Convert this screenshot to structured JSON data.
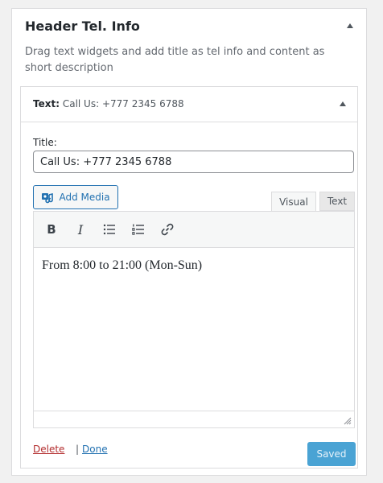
{
  "sidebar": {
    "title": "Header Tel. Info",
    "description": "Drag text widgets and add title as tel info and content as short description"
  },
  "widget": {
    "type_label": "Text:",
    "title_summary": "Call Us: +777 2345 6788",
    "title_label": "Title:",
    "title_value": "Call Us: +777 2345 6788",
    "add_media_label": "Add Media",
    "tabs": {
      "visual": "Visual",
      "text": "Text"
    },
    "toolbar_icons": [
      "bold-icon",
      "italic-icon",
      "bulleted-list-icon",
      "numbered-list-icon",
      "link-icon"
    ],
    "content": "From 8:00 to 21:00 (Mon-Sun)",
    "delete_label": "Delete",
    "separator": "|",
    "done_label": "Done",
    "saved_label": "Saved"
  },
  "colors": {
    "link_blue": "#2271b1",
    "delete_red": "#b32d2e",
    "saved_button": "#4aa3d4"
  }
}
